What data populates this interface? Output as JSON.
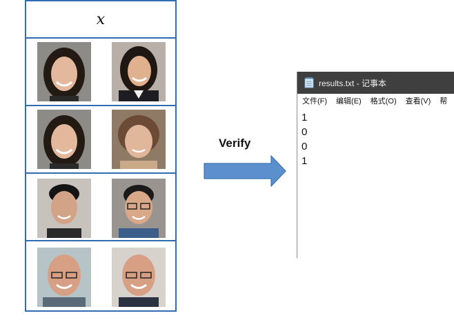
{
  "table": {
    "header": "x",
    "rows": [
      {
        "left": "woman-long-dark-hair-face",
        "right": "woman-business-attire-face"
      },
      {
        "left": "woman-long-dark-hair-face",
        "right": "older-woman-short-hair-face"
      },
      {
        "left": "young-man-dark-hair-face",
        "right": "man-glasses-face"
      },
      {
        "left": "bald-man-glasses-face",
        "right": "bald-man-glasses-face"
      }
    ]
  },
  "arrow": {
    "label": "Verify",
    "color": "#5b8fce"
  },
  "notepad": {
    "title": "results.txt - 记事本",
    "menu": [
      "文件(F)",
      "编辑(E)",
      "格式(O)",
      "查看(V)",
      "帮"
    ],
    "lines": [
      "1",
      "0",
      "0",
      "1"
    ]
  },
  "colors": {
    "table_border": "#2e6bb0",
    "titlebar": "#3f3f3f",
    "arrow_fill": "#5b8fce"
  }
}
